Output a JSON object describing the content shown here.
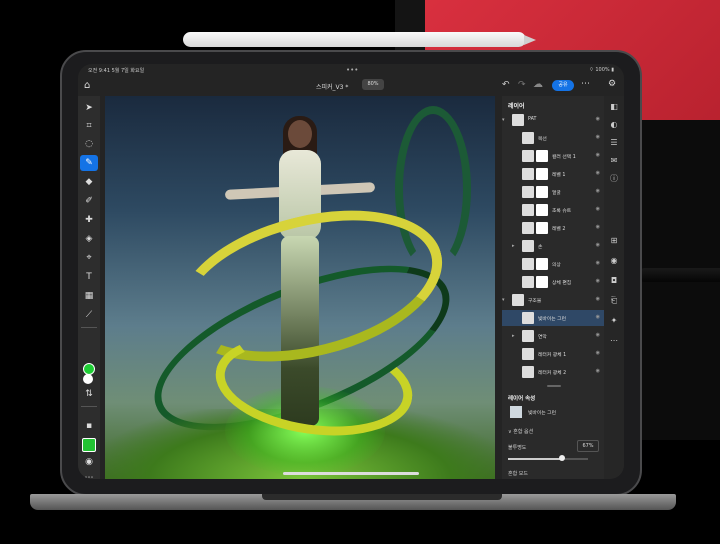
{
  "colors": {
    "accent": "#1473e6",
    "foreground_swatch": "#1fcf36",
    "background_swatch": "#ffffff"
  },
  "status_bar": {
    "time": "오전 9:41",
    "date": "5월 7일 화요일",
    "battery": "100%"
  },
  "header": {
    "document_title": "스피커_V3 *",
    "zoom": "80%",
    "share_label": "공유",
    "icons": [
      "home-icon",
      "undo-icon",
      "redo-icon",
      "cloud-icon",
      "more-icon",
      "settings-icon"
    ]
  },
  "toolbar": {
    "icons": [
      "move-icon",
      "transform-icon",
      "lasso-icon",
      "brush-icon",
      "eraser-icon",
      "paint-icon",
      "heal-icon",
      "fill-icon",
      "crop-icon",
      "type-icon",
      "image-icon",
      "eyedropper-icon",
      "swap-icon"
    ],
    "active": "brush-icon"
  },
  "layers_panel": {
    "title": "레이어",
    "layers": [
      {
        "name": "PAT",
        "indent": 0,
        "group": true,
        "expanded": true
      },
      {
        "name": "목선",
        "indent": 1
      },
      {
        "name": "컬러 선택 1",
        "indent": 1,
        "mask": true
      },
      {
        "name": "레벨 1",
        "indent": 1,
        "mask": true
      },
      {
        "name": "얼굴",
        "indent": 1,
        "mask": true
      },
      {
        "name": "초록 슈트",
        "indent": 1,
        "mask": true
      },
      {
        "name": "레벨 2",
        "indent": 1,
        "mask": true
      },
      {
        "name": "손",
        "indent": 1,
        "group": true,
        "expanded": false
      },
      {
        "name": "의상",
        "indent": 1,
        "mask": true
      },
      {
        "name": "상체 편집",
        "indent": 1,
        "mask": true
      },
      {
        "name": "구조물",
        "indent": 0,
        "group": true,
        "expanded": true
      },
      {
        "name": "빛바이는 그런",
        "indent": 1,
        "selected": true
      },
      {
        "name": "연막",
        "indent": 1,
        "group": true,
        "expanded": false
      },
      {
        "name": "레터커 광체 1",
        "indent": 1
      },
      {
        "name": "레터커 광체 2",
        "indent": 1
      }
    ]
  },
  "properties": {
    "title": "레이어 속성",
    "layer_name": "빛바이는 그런",
    "section": "혼합 옵션",
    "opacity_label": "불투명도",
    "opacity_value": "67%",
    "opacity": 0.67,
    "blend_label": "혼합 모드"
  },
  "side_icons": [
    "layers-icon",
    "adjust-icon",
    "properties-icon",
    "comments-icon",
    "info-icon",
    "add-layer-icon",
    "visibility-icon",
    "mask-icon",
    "clip-icon",
    "fx-icon",
    "more-options-icon"
  ]
}
